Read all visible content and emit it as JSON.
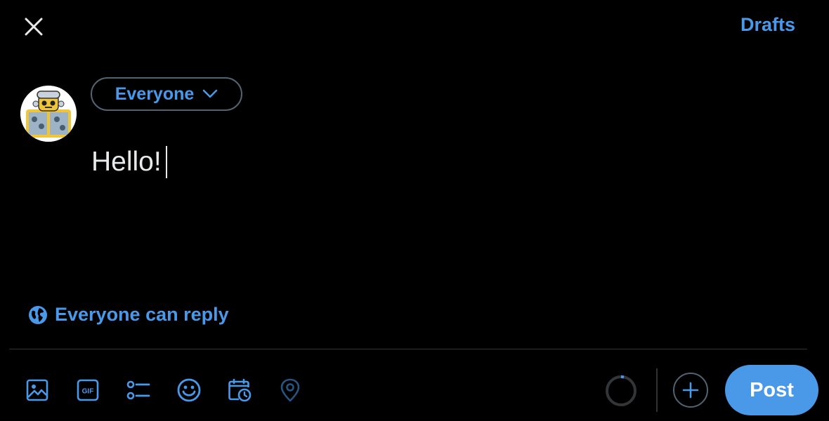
{
  "header": {
    "close_icon": "close-icon",
    "drafts_label": "Drafts"
  },
  "composer": {
    "audience_label": "Everyone",
    "text": "Hello!",
    "reply_setting_label": "Everyone can reply",
    "reply_icon": "globe-icon"
  },
  "toolbar": {
    "items": [
      {
        "name": "media",
        "icon": "image-icon"
      },
      {
        "name": "gif",
        "icon": "gif-icon"
      },
      {
        "name": "poll",
        "icon": "poll-icon"
      },
      {
        "name": "emoji",
        "icon": "emoji-icon"
      },
      {
        "name": "schedule",
        "icon": "schedule-icon"
      },
      {
        "name": "location",
        "icon": "location-icon"
      }
    ],
    "post_label": "Post",
    "add_icon": "plus-icon"
  },
  "colors": {
    "background": "#000000",
    "accent": "#4a99e9",
    "text": "#e7e9ea",
    "border": "#536471"
  }
}
